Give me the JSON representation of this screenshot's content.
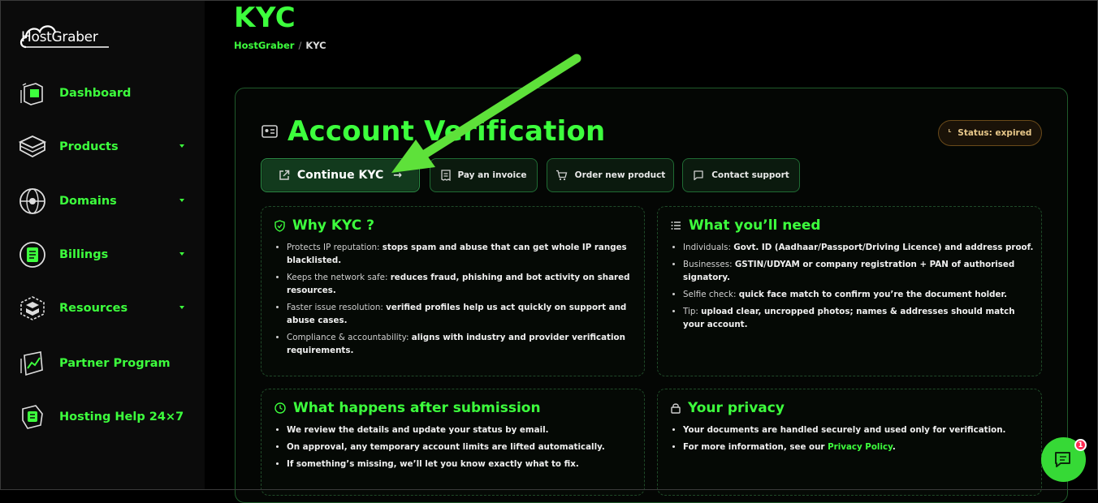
{
  "brand": {
    "logo_text_a": "Host",
    "logo_text_b": "Graber"
  },
  "sidebar": {
    "items": [
      {
        "label": "Dashboard",
        "icon": "dashboard-icon",
        "has_caret": false
      },
      {
        "label": "Products",
        "icon": "box-icon",
        "has_caret": true
      },
      {
        "label": "Domains",
        "icon": "globe-icon",
        "has_caret": true
      },
      {
        "label": "Billings",
        "icon": "billing-icon",
        "has_caret": true
      },
      {
        "label": "Resources",
        "icon": "resources-icon",
        "has_caret": true
      },
      {
        "label": "Partner Program",
        "icon": "partner-icon",
        "has_caret": false
      },
      {
        "label": "Hosting Help 24×7",
        "icon": "help-icon",
        "has_caret": false
      }
    ]
  },
  "header": {
    "title": "KYC",
    "breadcrumb_home": "HostGraber",
    "breadcrumb_sep": "/",
    "breadcrumb_current": "KYC"
  },
  "card": {
    "heading": "Account Verification",
    "status": "Status: expired",
    "buttons": {
      "continue_kyc": "Continue KYC",
      "pay_invoice": "Pay an invoice",
      "order_product": "Order new product",
      "contact_support": "Contact support"
    }
  },
  "panels": {
    "why": {
      "title": "Why KYC ?",
      "items": [
        {
          "lead": "Protects IP reputation: ",
          "bold": "stops spam and abuse that can get whole IP ranges blacklisted."
        },
        {
          "lead": "Keeps the network safe: ",
          "bold": "reduces fraud, phishing and bot activity on shared resources."
        },
        {
          "lead": "Faster issue resolution: ",
          "bold": "verified profiles help us act quickly on support and abuse cases."
        },
        {
          "lead": "Compliance & accountability: ",
          "bold": "aligns with industry and provider verification requirements."
        }
      ]
    },
    "need": {
      "title": "What you’ll need",
      "items": [
        {
          "lead": "Individuals: ",
          "bold": "Govt. ID (Aadhaar/Passport/Driving Licence) and address proof."
        },
        {
          "lead": "Businesses: ",
          "bold": "GSTIN/UDYAM or company registration + PAN of authorised signatory."
        },
        {
          "lead": "Selfie check: ",
          "bold": "quick face match to confirm you’re the document holder."
        },
        {
          "lead": "Tip: ",
          "bold": "upload clear, uncropped photos; names & addresses should match your account."
        }
      ]
    },
    "after": {
      "title": "What happens after submission",
      "items": [
        "We review the details and update your status by email.",
        "On approval, any temporary account limits are lifted automatically.",
        "If something’s missing, we’ll let you know exactly what to fix."
      ]
    },
    "privacy": {
      "title": "Your privacy",
      "item1": "Your documents are handled securely and used only for verification.",
      "item2_lead": "For more information, see our ",
      "item2_link": "Privacy Policy",
      "item2_end": "."
    }
  },
  "chat": {
    "badge_count": "1"
  },
  "colors": {
    "accent": "#3dff3d",
    "annotation_arrow": "#5ee13a",
    "status": "#e8c88a"
  }
}
